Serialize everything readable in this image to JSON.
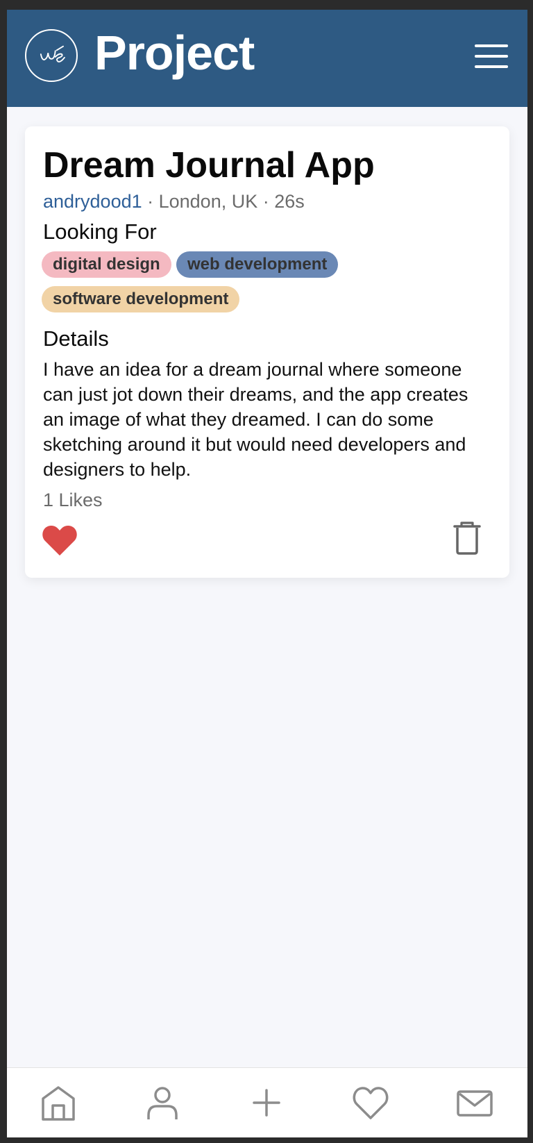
{
  "header": {
    "logo_icon": "ws-logo-icon",
    "title": "Project",
    "menu_icon": "hamburger-icon"
  },
  "post": {
    "title": "Dream Journal App",
    "author": "andrydood1",
    "location_time": " · London, UK · 26s",
    "looking_for_label": "Looking For",
    "tags": [
      {
        "label": "digital design",
        "color": "#f4b9c1"
      },
      {
        "label": "web development",
        "color": "#6a88b5"
      },
      {
        "label": "software development",
        "color": "#f1d3a6"
      }
    ],
    "details_label": "Details",
    "details": "I have an idea for a dream journal where someone can just jot down their dreams, and the app creates an image of what they dreamed. I can do some sketching around it but would need developers and designers to help.",
    "likes": "1 Likes",
    "like_icon": "heart-filled-icon",
    "like_color": "#db4a48",
    "delete_icon": "trash-icon"
  },
  "bottom_nav": {
    "items": [
      {
        "name": "home",
        "icon": "home-icon"
      },
      {
        "name": "profile",
        "icon": "user-icon"
      },
      {
        "name": "create",
        "icon": "plus-icon"
      },
      {
        "name": "favorites",
        "icon": "heart-outline-icon"
      },
      {
        "name": "messages",
        "icon": "mail-icon"
      }
    ]
  },
  "colors": {
    "brand": "#2e5a83",
    "author_link": "#2e5f98",
    "background": "#f6f7fb"
  }
}
